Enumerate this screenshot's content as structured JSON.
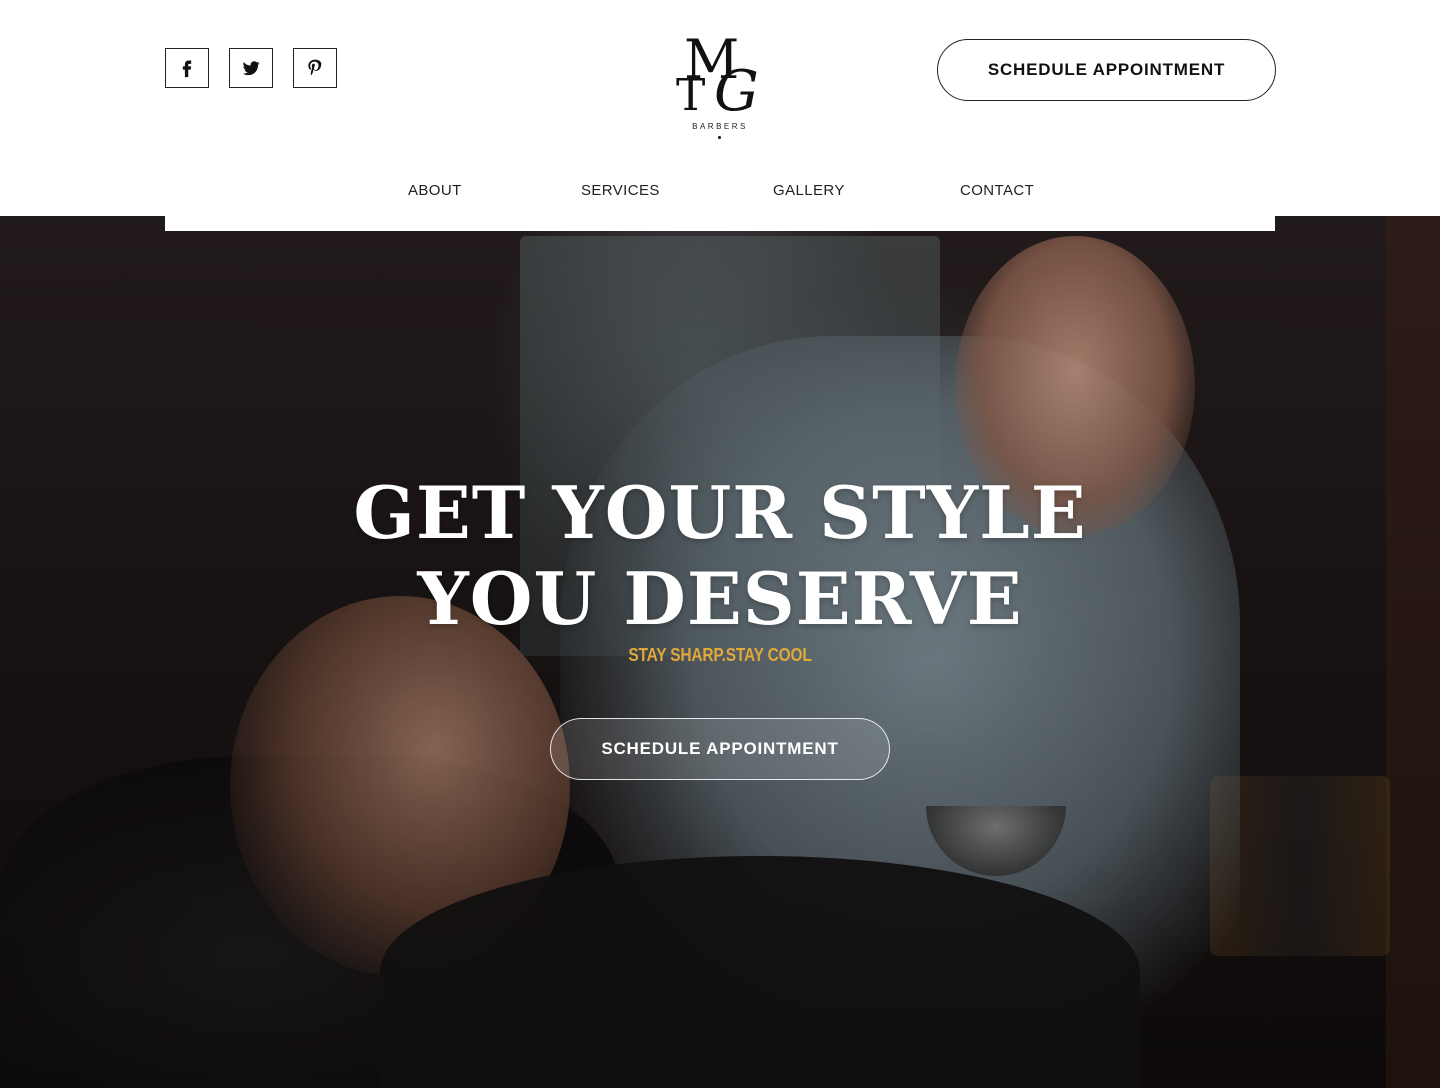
{
  "header": {
    "social": [
      {
        "name": "facebook-icon"
      },
      {
        "name": "twitter-icon"
      },
      {
        "name": "pinterest-icon"
      }
    ],
    "logo": {
      "monogram": [
        "M",
        "T",
        "G"
      ],
      "subtitle": "BARBERS"
    },
    "schedule_label": "SCHEDULE APPOINTMENT"
  },
  "nav": {
    "items": [
      {
        "label": "ABOUT"
      },
      {
        "label": "SERVICES"
      },
      {
        "label": "GALLERY"
      },
      {
        "label": "CONTACT"
      }
    ]
  },
  "hero": {
    "headline_line1": "GET YOUR STYLE",
    "headline_line2": "YOU DESERVE",
    "tagline": "STAY SHARP.STAY COOL",
    "schedule_label": "SCHEDULE APPOINTMENT",
    "accent_color": "#e0a93a"
  }
}
